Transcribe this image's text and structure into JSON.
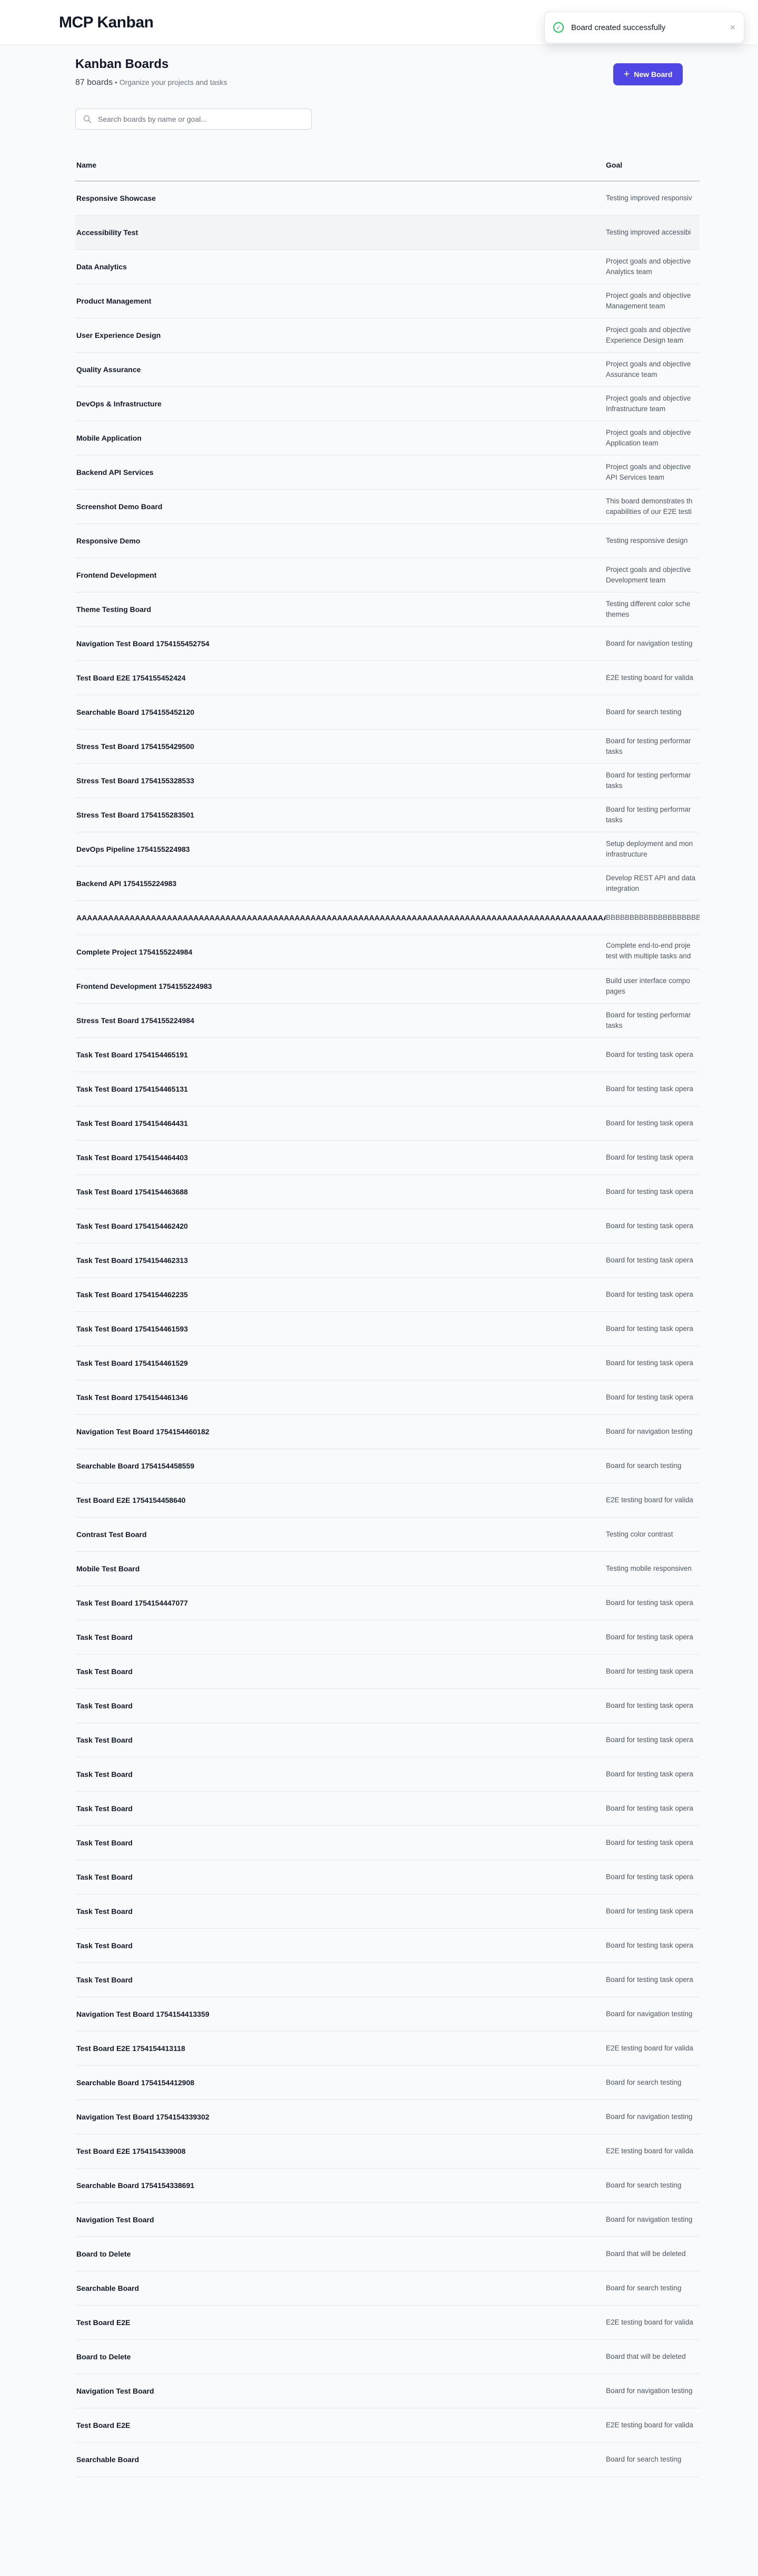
{
  "app": {
    "title": "MCP Kanban"
  },
  "toast": {
    "message": "Board created successfully",
    "close": "×",
    "icon": "check-circle-icon",
    "color": "#22c55e"
  },
  "page": {
    "title": "Kanban Boards",
    "board_count": "87 boards",
    "subtitle": " • Organize your projects and tasks",
    "new_button": "New Board",
    "new_button_icon": "plus",
    "accent": "#4f46e5"
  },
  "search": {
    "placeholder": "Search boards by name or goal..."
  },
  "table": {
    "columns": {
      "name": "Name",
      "goal": "Goal"
    },
    "rows": [
      {
        "name": "Responsive Showcase",
        "goal": [
          "Testing improved responsiv"
        ]
      },
      {
        "name": "Accessibility Test",
        "goal": [
          "Testing improved accessibi"
        ],
        "hover": true
      },
      {
        "name": "Data Analytics",
        "goal": [
          "Project goals and objective",
          "Analytics team"
        ]
      },
      {
        "name": "Product Management",
        "goal": [
          "Project goals and objective",
          "Management team"
        ]
      },
      {
        "name": "User Experience Design",
        "goal": [
          "Project goals and objective",
          "Experience Design team"
        ]
      },
      {
        "name": "Quality Assurance",
        "goal": [
          "Project goals and objective",
          "Assurance team"
        ]
      },
      {
        "name": "DevOps & Infrastructure",
        "goal": [
          "Project goals and objective",
          "Infrastructure team"
        ]
      },
      {
        "name": "Mobile Application",
        "goal": [
          "Project goals and objective",
          "Application team"
        ]
      },
      {
        "name": "Backend API Services",
        "goal": [
          "Project goals and objective",
          "API Services team"
        ]
      },
      {
        "name": "Screenshot Demo Board",
        "goal": [
          "This board demonstrates th",
          "capabilities of our E2E testi"
        ]
      },
      {
        "name": "Responsive Demo",
        "goal": [
          "Testing responsive design"
        ]
      },
      {
        "name": "Frontend Development",
        "goal": [
          "Project goals and objective",
          "Development team"
        ]
      },
      {
        "name": "Theme Testing Board",
        "goal": [
          "Testing different color sche",
          "themes"
        ]
      },
      {
        "name": "Navigation Test Board 1754155452754",
        "goal": [
          "Board for navigation testing"
        ]
      },
      {
        "name": "Test Board E2E 1754155452424",
        "goal": [
          "E2E testing board for valida"
        ]
      },
      {
        "name": "Searchable Board 1754155452120",
        "goal": [
          "Board for search testing"
        ]
      },
      {
        "name": "Stress Test Board 1754155429500",
        "goal": [
          "Board for testing performar",
          "tasks"
        ]
      },
      {
        "name": "Stress Test Board 1754155328533",
        "goal": [
          "Board for testing performar",
          "tasks"
        ]
      },
      {
        "name": "Stress Test Board 1754155283501",
        "goal": [
          "Board for testing performar",
          "tasks"
        ]
      },
      {
        "name": "DevOps Pipeline 1754155224983",
        "goal": [
          "Setup deployment and mon",
          "infrastructure"
        ]
      },
      {
        "name": "Backend API 1754155224983",
        "goal": [
          "Develop REST API and data",
          "integration"
        ]
      },
      {
        "name": "AAAAAAAAAAAAAAAAAAAAAAAAAAAAAAAAAAAAAAAAAAAAAAAAAAAAAAAAAAAAAAAAAAAAAAAAAAAAAAAAAAAAAAAAAAAAAAAAAAAAAAAAAAAAAAAAAAAAAAAA",
        "goal": [
          "BBBBBBBBBBBBBBBBBBBBBBBBBBBB"
        ]
      },
      {
        "name": "Complete Project 1754155224984",
        "goal": [
          "Complete end-to-end proje",
          "test with multiple tasks and",
          "management"
        ]
      },
      {
        "name": "Frontend Development 1754155224983",
        "goal": [
          "Build user interface compo",
          "pages"
        ]
      },
      {
        "name": "Stress Test Board 1754155224984",
        "goal": [
          "Board for testing performar",
          "tasks"
        ]
      },
      {
        "name": "Task Test Board 1754154465191",
        "goal": [
          "Board for testing task opera"
        ]
      },
      {
        "name": "Task Test Board 1754154465131",
        "goal": [
          "Board for testing task opera"
        ]
      },
      {
        "name": "Task Test Board 1754154464431",
        "goal": [
          "Board for testing task opera"
        ]
      },
      {
        "name": "Task Test Board 1754154464403",
        "goal": [
          "Board for testing task opera"
        ]
      },
      {
        "name": "Task Test Board 1754154463688",
        "goal": [
          "Board for testing task opera"
        ]
      },
      {
        "name": "Task Test Board 1754154462420",
        "goal": [
          "Board for testing task opera"
        ]
      },
      {
        "name": "Task Test Board 1754154462313",
        "goal": [
          "Board for testing task opera"
        ]
      },
      {
        "name": "Task Test Board 1754154462235",
        "goal": [
          "Board for testing task opera"
        ]
      },
      {
        "name": "Task Test Board 1754154461593",
        "goal": [
          "Board for testing task opera"
        ]
      },
      {
        "name": "Task Test Board 1754154461529",
        "goal": [
          "Board for testing task opera"
        ]
      },
      {
        "name": "Task Test Board 1754154461346",
        "goal": [
          "Board for testing task opera"
        ]
      },
      {
        "name": "Navigation Test Board 1754154460182",
        "goal": [
          "Board for navigation testing"
        ]
      },
      {
        "name": "Searchable Board 1754154458559",
        "goal": [
          "Board for search testing"
        ]
      },
      {
        "name": "Test Board E2E 1754154458640",
        "goal": [
          "E2E testing board for valida"
        ]
      },
      {
        "name": "Contrast Test Board",
        "goal": [
          "Testing color contrast"
        ]
      },
      {
        "name": "Mobile Test Board",
        "goal": [
          "Testing mobile responsiven"
        ]
      },
      {
        "name": "Task Test Board 1754154447077",
        "goal": [
          "Board for testing task opera"
        ]
      },
      {
        "name": "Task Test Board",
        "goal": [
          "Board for testing task opera"
        ]
      },
      {
        "name": "Task Test Board",
        "goal": [
          "Board for testing task opera"
        ]
      },
      {
        "name": "Task Test Board",
        "goal": [
          "Board for testing task opera"
        ]
      },
      {
        "name": "Task Test Board",
        "goal": [
          "Board for testing task opera"
        ]
      },
      {
        "name": "Task Test Board",
        "goal": [
          "Board for testing task opera"
        ]
      },
      {
        "name": "Task Test Board",
        "goal": [
          "Board for testing task opera"
        ]
      },
      {
        "name": "Task Test Board",
        "goal": [
          "Board for testing task opera"
        ]
      },
      {
        "name": "Task Test Board",
        "goal": [
          "Board for testing task opera"
        ]
      },
      {
        "name": "Task Test Board",
        "goal": [
          "Board for testing task opera"
        ]
      },
      {
        "name": "Task Test Board",
        "goal": [
          "Board for testing task opera"
        ]
      },
      {
        "name": "Task Test Board",
        "goal": [
          "Board for testing task opera"
        ]
      },
      {
        "name": "Navigation Test Board 1754154413359",
        "goal": [
          "Board for navigation testing"
        ]
      },
      {
        "name": "Test Board E2E 1754154413118",
        "goal": [
          "E2E testing board for valida"
        ]
      },
      {
        "name": "Searchable Board 1754154412908",
        "goal": [
          "Board for search testing"
        ]
      },
      {
        "name": "Navigation Test Board 1754154339302",
        "goal": [
          "Board for navigation testing"
        ]
      },
      {
        "name": "Test Board E2E 1754154339008",
        "goal": [
          "E2E testing board for valida"
        ]
      },
      {
        "name": "Searchable Board 1754154338691",
        "goal": [
          "Board for search testing"
        ]
      },
      {
        "name": "Navigation Test Board",
        "goal": [
          "Board for navigation testing"
        ]
      },
      {
        "name": "Board to Delete",
        "goal": [
          "Board that will be deleted"
        ]
      },
      {
        "name": "Searchable Board",
        "goal": [
          "Board for search testing"
        ]
      },
      {
        "name": "Test Board E2E",
        "goal": [
          "E2E testing board for valida"
        ]
      },
      {
        "name": "Board to Delete",
        "goal": [
          "Board that will be deleted"
        ]
      },
      {
        "name": "Navigation Test Board",
        "goal": [
          "Board for navigation testing"
        ]
      },
      {
        "name": "Test Board E2E",
        "goal": [
          "E2E testing board for valida"
        ]
      },
      {
        "name": "Searchable Board",
        "goal": [
          "Board for search testing"
        ]
      }
    ]
  }
}
